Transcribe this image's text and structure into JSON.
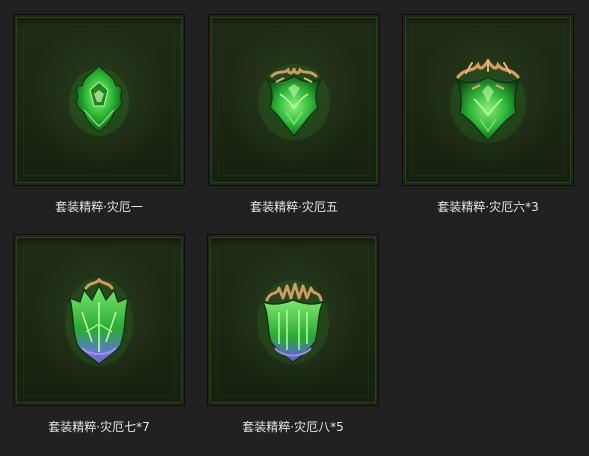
{
  "items": [
    {
      "label": "套装精粹·灾厄一"
    },
    {
      "label": "套装精粹·灾厄五"
    },
    {
      "label": "套装精粹·灾厄六*3"
    },
    {
      "label": "套装精粹·灾厄七*7"
    },
    {
      "label": "套装精粹·灾厄八*5"
    }
  ],
  "colors": {
    "background": "#212121",
    "tile_bg": "#1c2a12",
    "essence_green": "#3fd24a",
    "essence_gold": "#c9955a",
    "essence_purple": "#8a5cc8",
    "caption_text": "#e6e6e6"
  },
  "icons": [
    "essence-calamity-1-icon",
    "essence-calamity-5-icon",
    "essence-calamity-6-icon",
    "essence-calamity-7-icon",
    "essence-calamity-8-icon"
  ]
}
